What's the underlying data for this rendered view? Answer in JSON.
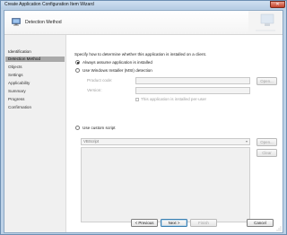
{
  "window": {
    "title": "Create Application Configuration Item Wizard",
    "close_glyph": "✕"
  },
  "header": {
    "title": "Detection Method"
  },
  "sidebar": {
    "items": [
      {
        "label": "Identification"
      },
      {
        "label": "Detection Method"
      },
      {
        "label": "Objects"
      },
      {
        "label": "Settings"
      },
      {
        "label": "Applicability"
      },
      {
        "label": "Summary"
      },
      {
        "label": "Progress"
      },
      {
        "label": "Confirmation"
      }
    ]
  },
  "main": {
    "instruction": "Specify how to determine whether this application is installed on a client.",
    "option_always": "Always assume application is installed",
    "option_msi": "Use Windows Installer (MSI) detection",
    "product_code_label": "Product code:",
    "version_label": "Version:",
    "per_user_label": "This application is installed per-user",
    "option_script": "Use custom script",
    "script_language": "VBScript",
    "open_label": "Open...",
    "clear_label": "Clear"
  },
  "footer": {
    "previous": "< Previous",
    "next": "Next >",
    "finish": "Finish",
    "cancel": "Cancel"
  }
}
